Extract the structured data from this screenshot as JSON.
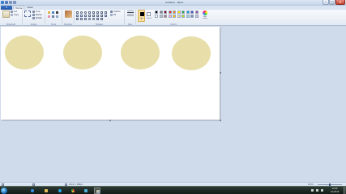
{
  "window": {
    "title": "Untitled - Paint",
    "minimize_glyph": "–",
    "maximize_glyph": "□",
    "close_glyph": "✕"
  },
  "tabs": {
    "file": "▾",
    "home": "Home",
    "view": "View"
  },
  "ribbon": {
    "clipboard": {
      "label": "Clipboard",
      "paste": "Paste",
      "cut": "Cut",
      "copy": "Copy"
    },
    "image": {
      "label": "Image",
      "select": "Select",
      "crop": "Crop",
      "resize": "Resize",
      "rotate": "Rotate"
    },
    "tools": {
      "label": "Tools"
    },
    "brushes": {
      "label": "Brushes"
    },
    "shapes": {
      "label": "Shapes",
      "outline": "Outline",
      "fill": "Fill"
    },
    "size": {
      "label": "Size"
    },
    "colors": {
      "label": "Colors",
      "color1": "Color 1",
      "color2": "Color 2",
      "edit": "Edit colors",
      "palette_row1": [
        "#000000",
        "#7f7f7f",
        "#880015",
        "#ed1c24",
        "#ff7f27",
        "#fff200",
        "#22b14c",
        "#00a2e8",
        "#3f48cc",
        "#a349a4"
      ],
      "palette_row2": [
        "#ffffff",
        "#c3c3c3",
        "#b97a57",
        "#ffaec9",
        "#ffc90e",
        "#efe4b0",
        "#b5e61d",
        "#99d9ea",
        "#7092be",
        "#c8bfe7"
      ]
    }
  },
  "canvas": {
    "shape_fill": "#e8deaa",
    "circles": 4
  },
  "status": {
    "size_text": "1043 × 389px",
    "zoom": "100%"
  },
  "taskbar": {
    "time": "12:00",
    "date": "1/1/2014"
  },
  "colors": {
    "accent": "#2456a4",
    "workspace": "#cfdbeb",
    "taskbar": "#1c2620"
  }
}
